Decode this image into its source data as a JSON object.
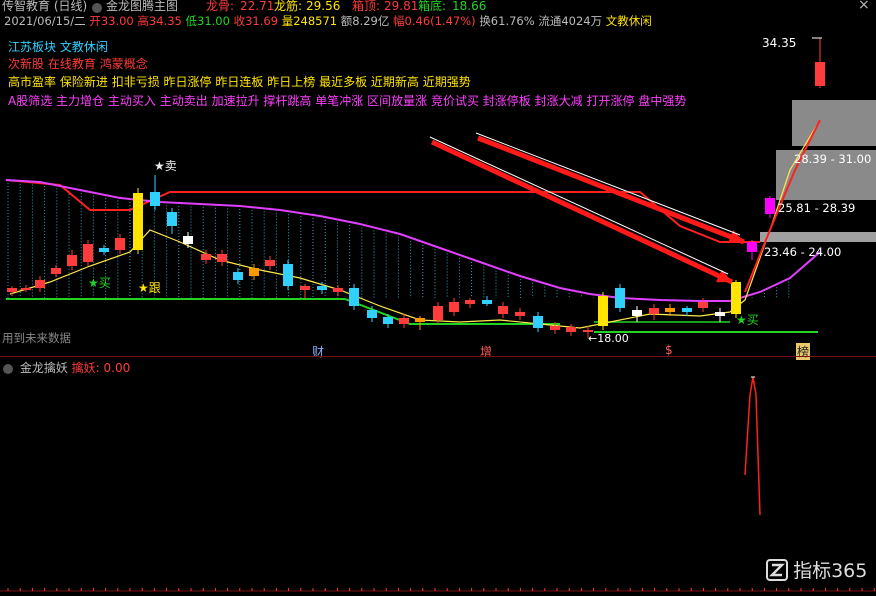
{
  "titlebar": {
    "stock_title": "传智教育 (日线)",
    "indicator_name": "金龙图腾主图",
    "items": [
      {
        "label": "龙骨:",
        "value": "22.71",
        "color": "#ff3b3b"
      },
      {
        "label": "龙筋:",
        "value": "29.56",
        "color": "#ffe400"
      },
      {
        "label": "箱顶:",
        "value": "29.81",
        "color": "#ff3b3b"
      },
      {
        "label": "箱底:",
        "value": "18.66",
        "color": "#22d422"
      }
    ],
    "close_glyph": "×"
  },
  "infobar": {
    "date": "2021/06/15/二",
    "open": "开33.00",
    "high": "高34.35",
    "low": "低31.00",
    "close": "收31.69",
    "volume": "量248571",
    "amount": "额8.29亿",
    "change": "幅0.46(1.47%)",
    "turnover": "换61.76%",
    "float": "流通4024万",
    "sector": "文教休闲"
  },
  "tags": {
    "line1": [
      "江苏板块",
      "文教休闲"
    ],
    "line2": [
      "次新股",
      "在线教育",
      "鸿蒙概念"
    ],
    "line3": [
      "高市盈率",
      "保险新进",
      "扣非亏损",
      "昨日涨停",
      "昨日连板",
      "昨日上榜",
      "最近多板",
      "近期新高",
      "近期强势"
    ],
    "line4": [
      "A股筛选",
      "主力增仓",
      "主动买入",
      "主动卖出",
      "加速拉升",
      "撑杆跳高",
      "单笔冲涨",
      "区间放量涨",
      "竞价试买",
      "封涨停板",
      "封涨大减",
      "打开涨停",
      "盘中强势"
    ]
  },
  "chart": {
    "price_labels": {
      "high": "34.35",
      "low": "←18.00",
      "box1": "28.39 - 31.00",
      "box2": "25.81 - 28.39",
      "box3": "23.46 - 24.00"
    },
    "signals": {
      "sell": "★卖",
      "buy1": "★买",
      "follow": "★跟",
      "buy2": "★买"
    },
    "future_note": "用到未来数据",
    "markers": [
      "财",
      "增",
      "$",
      "榜"
    ]
  },
  "indicator": {
    "name": "金龙擒妖",
    "value_label": "擒妖:",
    "value": "0.00"
  },
  "watermark": {
    "text": "指标365"
  },
  "colors": {
    "up": "#ff3b3b",
    "down": "#30d0ff",
    "yellow_candle": "#ffe400",
    "ma_magenta": "#e040ff",
    "box_line": "#ff2020",
    "support_green": "#22d422"
  }
}
